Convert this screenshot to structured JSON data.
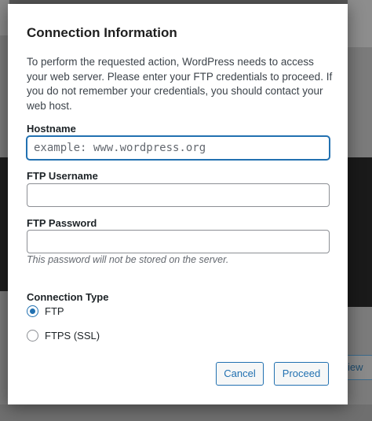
{
  "dialog": {
    "title": "Connection Information",
    "intro": "To perform the requested action, WordPress needs to access your web server. Please enter your FTP credentials to proceed. If you do not remember your credentials, you should contact your web host."
  },
  "fields": {
    "hostname": {
      "label": "Hostname",
      "placeholder": "example: www.wordpress.org",
      "value": ""
    },
    "username": {
      "label": "FTP Username",
      "value": ""
    },
    "password": {
      "label": "FTP Password",
      "value": "",
      "note": "This password will not be stored on the server."
    }
  },
  "connection_type": {
    "label": "Connection Type",
    "options": [
      {
        "label": "FTP",
        "checked": true
      },
      {
        "label": "FTPS (SSL)",
        "checked": false
      }
    ]
  },
  "buttons": {
    "cancel": "Cancel",
    "proceed": "Proceed"
  },
  "background": {
    "partial_button": "iew"
  },
  "colors": {
    "accent": "#2271b1",
    "text": "#1d2327",
    "muted": "#646970"
  }
}
